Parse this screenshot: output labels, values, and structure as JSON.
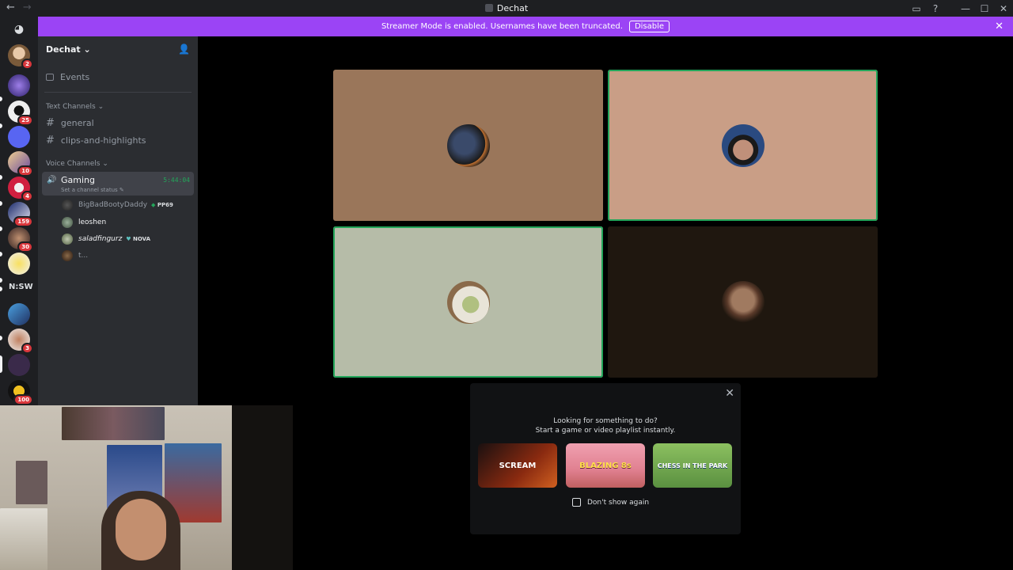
{
  "titlebar": {
    "title": "Dechat"
  },
  "banner": {
    "text": "Streamer Mode is enabled. Usernames have been truncated.",
    "disable_label": "Disable"
  },
  "servers": [
    {
      "badge": "2"
    },
    {
      "badge": ""
    },
    {
      "badge": "25"
    },
    {
      "badge": ""
    },
    {
      "badge": "10"
    },
    {
      "badge": "4"
    },
    {
      "badge": "159"
    },
    {
      "badge": "30"
    },
    {
      "badge": ""
    },
    {
      "text": "N:SW"
    },
    {
      "badge": ""
    },
    {
      "badge": "3"
    },
    {
      "badge": ""
    },
    {
      "badge": "100"
    }
  ],
  "sidebar": {
    "guild_name": "Dechat",
    "events_label": "Events",
    "text_category": "Text Channels",
    "text_channels": [
      "general",
      "clips-and-highlights"
    ],
    "voice_category": "Voice Channels",
    "voice_channel": {
      "name": "Gaming",
      "time": "5:44:04",
      "status": "Set a channel status"
    },
    "members": [
      {
        "name": "BigBadBootyDaddy",
        "tag": "PP69"
      },
      {
        "name": "leoshen",
        "tag": ""
      },
      {
        "name": "saladfingurz",
        "tag": "NOVA"
      },
      {
        "name": "t...",
        "tag": ""
      }
    ]
  },
  "panel": {
    "line1": "Looking for something to do?",
    "line2": "Start a game or video playlist instantly.",
    "games": [
      "SCREAM",
      "BLAZING 8s",
      "CHESS IN THE PARK"
    ],
    "dont_show": "Don't show again"
  },
  "colors": {
    "accent": "#9b44f5",
    "speaking": "#23a55a",
    "badge": "#da373c"
  }
}
